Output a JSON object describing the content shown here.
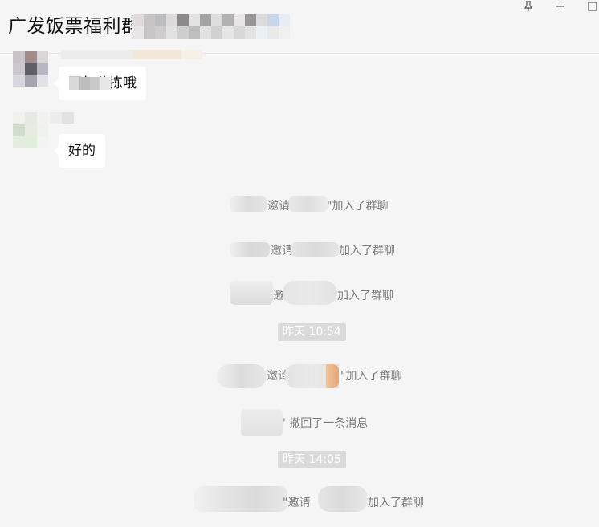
{
  "header": {
    "title": "广发饭票福利群",
    "pin_label": "pin-icon",
    "minimize_label": "minimize-icon",
    "maximize_label": "maximize-icon"
  },
  "messages": [
    {
      "type": "bubble",
      "text": "下午分拣哦"
    },
    {
      "type": "bubble",
      "text": "好的"
    }
  ],
  "system_messages": [
    {
      "mid": "邀请",
      "tail": "加入了群聊",
      "quote": "\""
    },
    {
      "mid": "邀请",
      "tail": "加入了群聊"
    },
    {
      "mid": "邀",
      "tail": "加入了群聊"
    },
    {
      "mid": "邀请",
      "tail": "加入了群聊",
      "quote": "\""
    },
    {
      "mid": "撤回了一条消息",
      "quote": "'"
    },
    {
      "mid": "邀请",
      "tail": "加入了群聊",
      "quote": "\""
    }
  ],
  "timestamps": [
    "昨天 10:54",
    "昨天 14:05"
  ],
  "colors": {
    "background": "#f5f5f5",
    "bubble": "#ffffff",
    "system_text": "#7a7a7a",
    "timestamp_bg": "#dadada"
  }
}
